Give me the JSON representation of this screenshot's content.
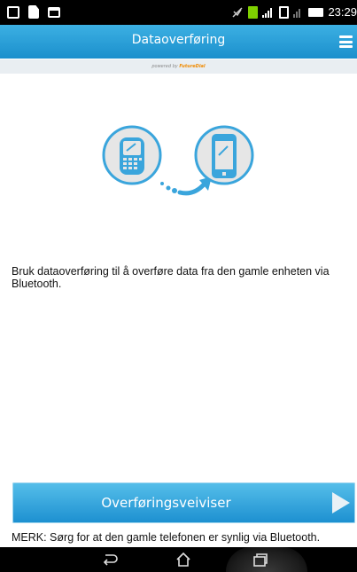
{
  "status_bar": {
    "time": "23:29",
    "left_icons": [
      "calendar-icon",
      "document-icon",
      "window-icon"
    ],
    "right_icons": [
      "mute-icon",
      "sim1-icon",
      "signal-icon",
      "sim2-icon",
      "signal2-icon",
      "battery-icon"
    ]
  },
  "header": {
    "title": "Dataoverføring",
    "menu_icon": "hamburger-menu-icon"
  },
  "powered": {
    "prefix": "powered by",
    "brand": "FutureDial"
  },
  "illustration": {
    "from_icon": "old-phone-icon",
    "to_icon": "smartphone-icon",
    "accent": "#1b8fcc"
  },
  "main": {
    "description": "Bruk dataoverføring til å overføre data fra den gamle enheten via Bluetooth."
  },
  "wizard": {
    "label": "Overføringsveiviser",
    "arrow_icon": "play-arrow-icon"
  },
  "note": "MERK: Sørg for at den gamle telefonen er synlig via Bluetooth.",
  "nav_bar": {
    "icons": [
      "back-icon",
      "home-icon",
      "recent-apps-icon"
    ]
  },
  "colors": {
    "header_top": "#3cb0e3",
    "header_bottom": "#1b8fcc",
    "button_top": "#56bfea",
    "button_bottom": "#1c8fd0"
  }
}
